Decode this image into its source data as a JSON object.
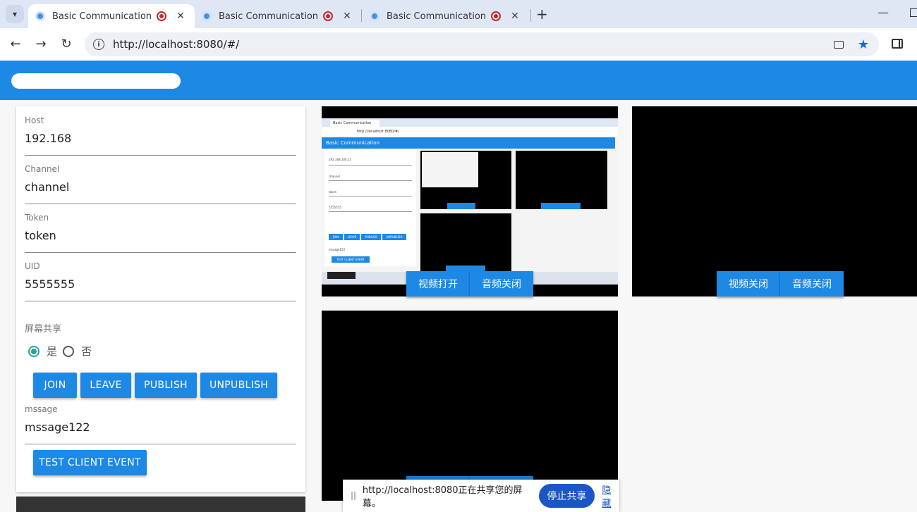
{
  "browser": {
    "tabs": [
      {
        "title": "Basic Communication",
        "active": true
      },
      {
        "title": "Basic Communication",
        "active": false
      },
      {
        "title": "Basic Communication",
        "active": false
      }
    ],
    "new_tab_symbol": "+",
    "address": "http://localhost:8080/#/",
    "icons": [
      "chevron-down-icon",
      "back-icon",
      "forward-icon",
      "reload-icon",
      "info-icon",
      "camera-icon",
      "star-icon",
      "side-panel-icon"
    ]
  },
  "form": {
    "host": {
      "label": "Host",
      "value": "192.168"
    },
    "channel": {
      "label": "Channel",
      "value": "channel"
    },
    "token": {
      "label": "Token",
      "value": "token"
    },
    "uid": {
      "label": "UID",
      "value": "5555555"
    },
    "screen_share": {
      "label": "屏幕共享",
      "yes": "是",
      "no": "否",
      "selected": "yes"
    },
    "buttons": {
      "join": "JOIN",
      "leave": "LEAVE",
      "publish": "PUBLISH",
      "unpublish": "UNPUBLISH"
    },
    "message": {
      "label": "mssage",
      "value": "mssage122"
    },
    "test_button": "TEST CLIENT EVENT"
  },
  "videos": {
    "local": {
      "video_btn": "视频打开",
      "audio_btn": "音频关闭"
    },
    "remote1": {
      "video_btn": "视频关闭",
      "audio_btn": "音频关闭"
    }
  },
  "thumbnail": {
    "app_title": "Basic Communication",
    "url": "http://localhost:8080/#/",
    "host": "192.168.100.23",
    "channel": "channel",
    "token": "token",
    "uid": "5555555",
    "message": "mssage122",
    "buttons": [
      "JOIN",
      "LEAVE",
      "PUBLISH",
      "UNPUBLISH"
    ],
    "test_button": "TEST CLIENT EVENT",
    "video_btn": "视频打开",
    "audio_btn": "音频关闭"
  },
  "share_bar": {
    "text": "http://localhost:8080正在共享您的屏幕。",
    "stop": "停止共享",
    "hide": "隐藏"
  }
}
